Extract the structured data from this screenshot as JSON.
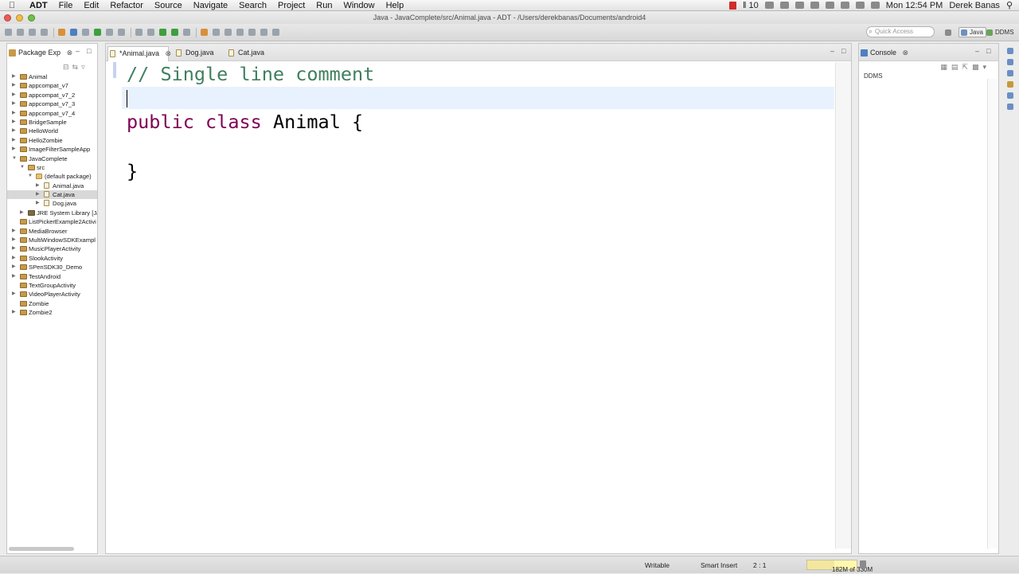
{
  "menubar": {
    "app": "ADT",
    "items": [
      "File",
      "Edit",
      "Refactor",
      "Source",
      "Navigate",
      "Search",
      "Project",
      "Run",
      "Window",
      "Help"
    ],
    "status_count": "10",
    "clock": "Mon 12:54 PM",
    "user": "Derek Banas"
  },
  "window": {
    "title": "Java - JavaComplete/src/Animal.java - ADT - /Users/derekbanas/Documents/android4"
  },
  "toolbar": {
    "quick_access_placeholder": "Quick Access",
    "perspectives": [
      "Java",
      "DDMS"
    ]
  },
  "package_explorer": {
    "tab_label": "Package Exp",
    "tree": [
      {
        "label": "Animal",
        "icon": "project-icon",
        "depth": 0,
        "expander": "collapsed"
      },
      {
        "label": "appcompat_v7",
        "icon": "project-icon",
        "depth": 0,
        "expander": "collapsed"
      },
      {
        "label": "appcompat_v7_2",
        "icon": "project-icon",
        "depth": 0,
        "expander": "collapsed"
      },
      {
        "label": "appcompat_v7_3",
        "icon": "project-icon",
        "depth": 0,
        "expander": "collapsed"
      },
      {
        "label": "appcompat_v7_4",
        "icon": "project-icon",
        "depth": 0,
        "expander": "collapsed"
      },
      {
        "label": "BridgeSample",
        "icon": "project-icon",
        "depth": 0,
        "expander": "collapsed"
      },
      {
        "label": "HelloWorld",
        "icon": "project-icon",
        "depth": 0,
        "expander": "collapsed"
      },
      {
        "label": "HelloZombie",
        "icon": "project-icon",
        "depth": 0,
        "expander": "collapsed"
      },
      {
        "label": "ImageFilterSampleApp",
        "icon": "project-icon",
        "depth": 0,
        "expander": "collapsed"
      },
      {
        "label": "JavaComplete",
        "icon": "project-icon",
        "depth": 0,
        "expander": "expanded"
      },
      {
        "label": "src",
        "icon": "source-folder-icon",
        "depth": 1,
        "expander": "expanded"
      },
      {
        "label": "(default package)",
        "icon": "package-icon",
        "depth": 2,
        "expander": "expanded"
      },
      {
        "label": "Animal.java",
        "icon": "java-file-icon",
        "depth": 3,
        "expander": "collapsed"
      },
      {
        "label": "Cat.java",
        "icon": "java-file-icon",
        "depth": 3,
        "expander": "collapsed",
        "selected": true
      },
      {
        "label": "Dog.java",
        "icon": "java-file-icon",
        "depth": 3,
        "expander": "collapsed"
      },
      {
        "label": "JRE System Library [Ja",
        "icon": "library-icon",
        "depth": 1,
        "expander": "collapsed"
      },
      {
        "label": "ListPickerExample2Activi",
        "icon": "project-icon",
        "depth": 0,
        "expander": "none"
      },
      {
        "label": "MediaBrowser",
        "icon": "project-icon",
        "depth": 0,
        "expander": "collapsed"
      },
      {
        "label": "MultiWindowSDKExampl",
        "icon": "project-icon",
        "depth": 0,
        "expander": "collapsed"
      },
      {
        "label": "MusicPlayerActivity",
        "icon": "project-icon",
        "depth": 0,
        "expander": "collapsed"
      },
      {
        "label": "SlookActivity",
        "icon": "project-icon",
        "depth": 0,
        "expander": "collapsed"
      },
      {
        "label": "SPenSDK30_Demo",
        "icon": "project-icon",
        "depth": 0,
        "expander": "collapsed"
      },
      {
        "label": "TestAndroid",
        "icon": "project-icon",
        "depth": 0,
        "expander": "collapsed"
      },
      {
        "label": "TextGroupActivity",
        "icon": "project-icon",
        "depth": 0,
        "expander": "none"
      },
      {
        "label": "VideoPlayerActivity",
        "icon": "project-icon",
        "depth": 0,
        "expander": "collapsed"
      },
      {
        "label": "Zombie",
        "icon": "project-icon",
        "depth": 0,
        "expander": "none"
      },
      {
        "label": "Zombie2",
        "icon": "project-icon",
        "depth": 0,
        "expander": "collapsed"
      }
    ]
  },
  "editor": {
    "tabs": [
      "*Animal.java",
      "Dog.java",
      "Cat.java"
    ],
    "code": {
      "comment": "// Single line comment",
      "kw_public": "public",
      "kw_class": "class",
      "class_decl": "Animal {",
      "close_brace": "}"
    }
  },
  "console": {
    "tab_label": "Console",
    "content_label": "DDMS"
  },
  "statusbar": {
    "writable": "Writable",
    "insert_mode": "Smart Insert",
    "position": "2 : 1",
    "heap": "182M of 330M",
    "heap_used_fraction": 0.55
  },
  "colors": {
    "comment": "#3f7f5f",
    "keyword": "#7f0055",
    "current_line": "#e8f2fe"
  }
}
